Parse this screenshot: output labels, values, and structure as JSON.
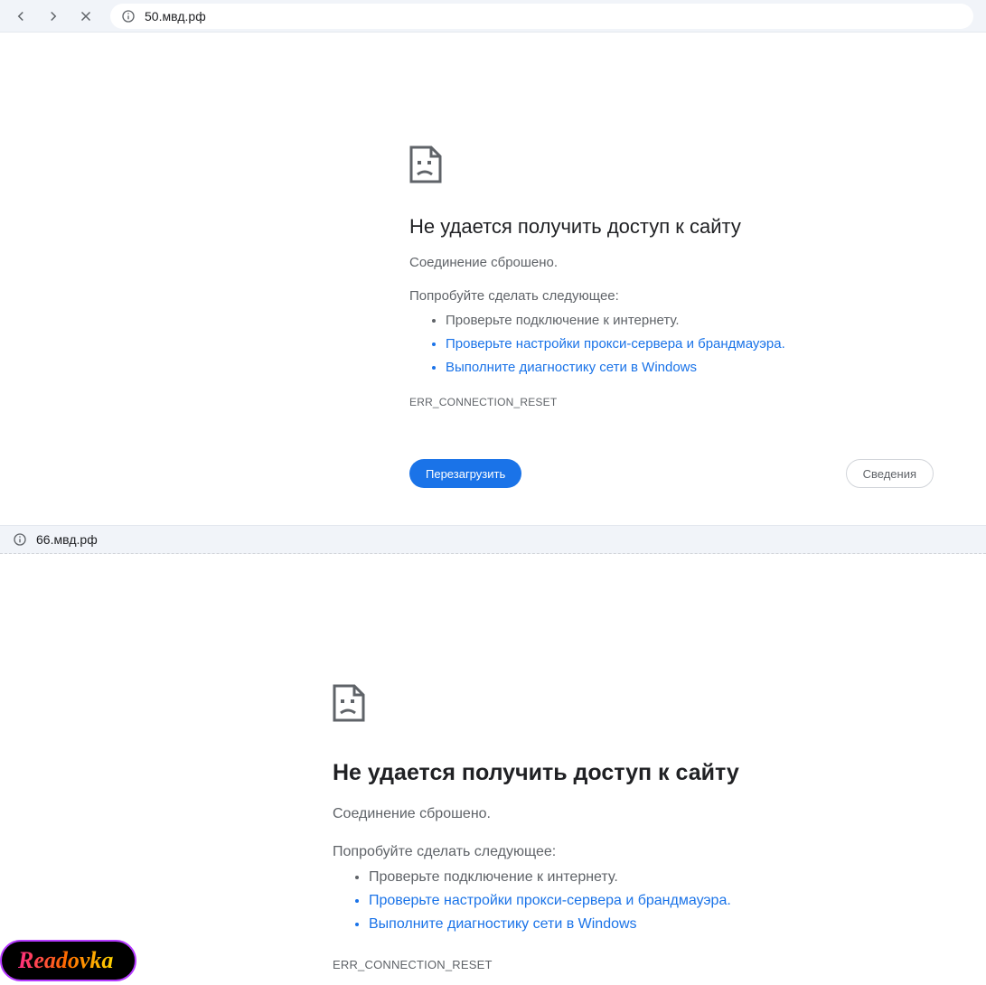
{
  "browser1": {
    "url": "50.мвд.рф",
    "error": {
      "title": "Не удается получить доступ к сайту",
      "subtitle": "Соединение сброшено.",
      "try_label": "Попробуйте сделать следующее:",
      "suggestions": [
        "Проверьте подключение к интернету.",
        "Проверьте настройки прокси-сервера и брандмауэра",
        "Выполните диагностику сети в Windows"
      ],
      "code": "ERR_CONNECTION_RESET",
      "reload_label": "Перезагрузить",
      "details_label": "Сведения"
    }
  },
  "browser2": {
    "url": "66.мвд.рф",
    "error": {
      "title": "Не удается получить доступ к сайту",
      "subtitle": "Соединение сброшено.",
      "try_label": "Попробуйте сделать следующее:",
      "suggestions": [
        "Проверьте подключение к интернету.",
        "Проверьте настройки прокси-сервера и брандмауэра",
        "Выполните диагностику сети в Windows"
      ],
      "code": "ERR_CONNECTION_RESET"
    }
  },
  "watermark": {
    "text": "Readovka"
  }
}
